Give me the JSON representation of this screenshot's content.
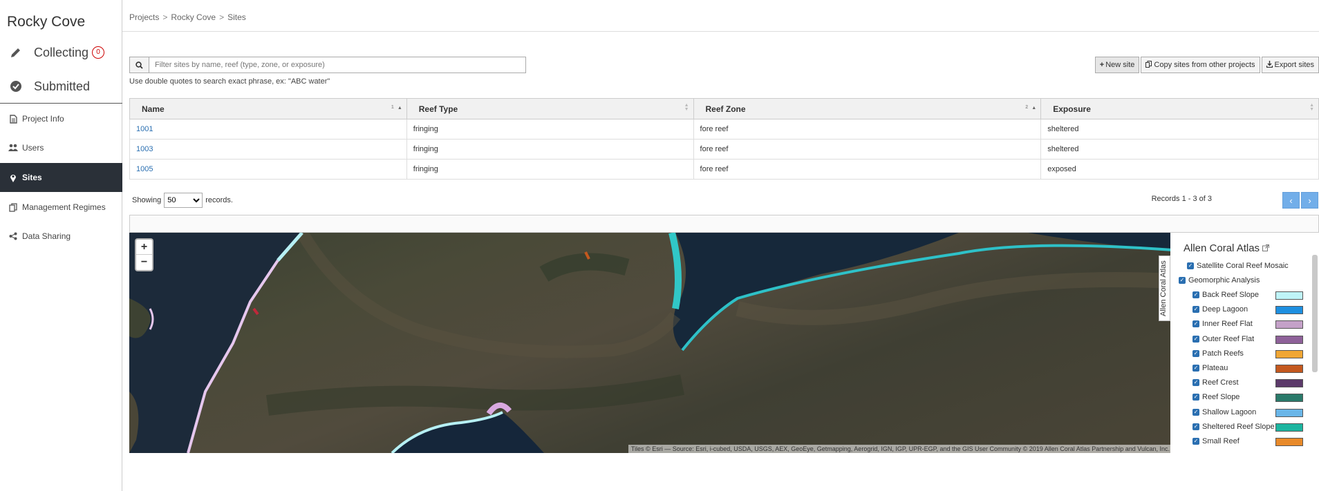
{
  "sidebar": {
    "title": "Rocky Cove",
    "collecting": {
      "label": "Collecting",
      "badge": "0"
    },
    "submitted": {
      "label": "Submitted"
    },
    "items": [
      {
        "label": "Project Info",
        "icon": "file-icon"
      },
      {
        "label": "Users",
        "icon": "users-icon"
      },
      {
        "label": "Sites",
        "icon": "map-marker-icon",
        "active": true
      },
      {
        "label": "Management Regimes",
        "icon": "copy-icon"
      },
      {
        "label": "Data Sharing",
        "icon": "share-icon"
      }
    ]
  },
  "breadcrumb": {
    "items": [
      "Projects",
      "Rocky Cove",
      "Sites"
    ],
    "separator": ">"
  },
  "search": {
    "placeholder": "Filter sites by name, reef (type, zone, or exposure)",
    "hint": "Use double quotes to search exact phrase, ex: \"ABC water\""
  },
  "toolbar": {
    "new_site": "New site",
    "copy_sites": "Copy sites from other projects",
    "export_sites": "Export sites"
  },
  "table": {
    "columns": [
      {
        "label": "Name",
        "sort_order": "1"
      },
      {
        "label": "Reef Type",
        "sort_order": ""
      },
      {
        "label": "Reef Zone",
        "sort_order": "2"
      },
      {
        "label": "Exposure",
        "sort_order": ""
      }
    ],
    "rows": [
      [
        "1001",
        "fringing",
        "fore reef",
        "sheltered"
      ],
      [
        "1003",
        "fringing",
        "fore reef",
        "sheltered"
      ],
      [
        "1005",
        "fringing",
        "fore reef",
        "exposed"
      ]
    ]
  },
  "pagination": {
    "showing_label": "Showing",
    "page_size": "50",
    "records_label": "records.",
    "records_range": "Records 1 - 3 of 3"
  },
  "map": {
    "zoom_in": "+",
    "zoom_out": "−",
    "attribution": "Tiles © Esri — Source: Esri, i-cubed, USDA, USGS, AEX, GeoEye, Getmapping, Aerogrid, IGN, IGP, UPR-EGP, and the GIS User Community © 2019 Allen Coral Atlas Partnership and Vulcan, Inc."
  },
  "legend": {
    "tab_label": "Allen Coral Atlas",
    "title": "Allen Coral Atlas",
    "mosaic": "Satellite Coral Reef Mosaic",
    "geomorphic": "Geomorphic Analysis",
    "classes": [
      {
        "label": "Back Reef Slope",
        "color": "#bff4f8"
      },
      {
        "label": "Deep Lagoon",
        "color": "#1e8fe0"
      },
      {
        "label": "Inner Reef Flat",
        "color": "#c4a1c8"
      },
      {
        "label": "Outer Reef Flat",
        "color": "#8e6199"
      },
      {
        "label": "Patch Reefs",
        "color": "#f0a634"
      },
      {
        "label": "Plateau",
        "color": "#c4581e"
      },
      {
        "label": "Reef Crest",
        "color": "#5c3a6a"
      },
      {
        "label": "Reef Slope",
        "color": "#2a7a6a"
      },
      {
        "label": "Shallow Lagoon",
        "color": "#6ab6e8"
      },
      {
        "label": "Sheltered Reef Slope",
        "color": "#1cb5a0"
      },
      {
        "label": "Small Reef",
        "color": "#e88a2a"
      }
    ]
  }
}
